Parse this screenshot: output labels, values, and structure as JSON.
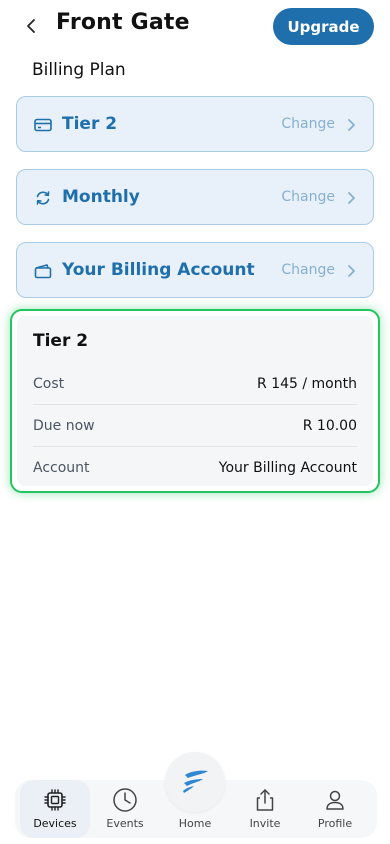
{
  "header": {
    "title": "Front Gate",
    "upgrade_label": "Upgrade"
  },
  "section_label": "Billing Plan",
  "options": [
    {
      "label": "Tier 2",
      "change": "Change",
      "icon": "credit-card-icon"
    },
    {
      "label": "Monthly",
      "change": "Change",
      "icon": "refresh-icon"
    },
    {
      "label": "Your Billing Account",
      "change": "Change",
      "icon": "wallet-icon"
    }
  ],
  "summary": {
    "title": "Tier 2",
    "rows": [
      {
        "key": "Cost",
        "value": "R 145 / month"
      },
      {
        "key": "Due now",
        "value": "R 10.00"
      },
      {
        "key": "Account",
        "value": "Your Billing Account"
      }
    ]
  },
  "tabbar": {
    "devices": "Devices",
    "events": "Events",
    "home": "Home",
    "invite": "Invite",
    "profile": "Profile",
    "active": "Devices"
  },
  "colors": {
    "accent": "#1f6fad",
    "option_bg": "#e8f1f9",
    "option_border": "#a9cbe6",
    "highlight": "#22c55e"
  }
}
